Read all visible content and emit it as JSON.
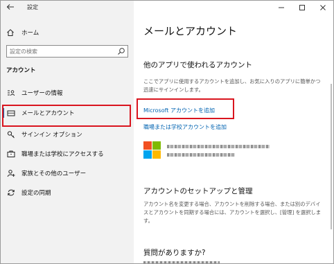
{
  "window": {
    "app_title": "設定",
    "controls": {
      "minimize": "—",
      "maximize": "☐",
      "close": "✕"
    }
  },
  "sidebar": {
    "home_label": "ホーム",
    "search_placeholder": "設定の検索",
    "section_label": "アカウント",
    "items": [
      {
        "label": "ユーザーの情報",
        "icon": "user-info-icon"
      },
      {
        "label": "メールとアカウント",
        "icon": "mail-icon",
        "selected": true
      },
      {
        "label": "サインイン オプション",
        "icon": "key-icon"
      },
      {
        "label": "職場または学校にアクセスする",
        "icon": "briefcase-icon"
      },
      {
        "label": "家族とその他のユーザー",
        "icon": "person-add-icon"
      },
      {
        "label": "設定の同期",
        "icon": "sync-icon"
      }
    ]
  },
  "main": {
    "page_title": "メールとアカウント",
    "other_apps_heading": "他のアプリで使われるアカウント",
    "other_apps_desc": "ここでアプリに使用するアカウントを追加し、お気に入りのアプリに簡単かつ迅速にサインインします。",
    "add_ms_account_link": "Microsoft アカウントを追加",
    "add_work_account_link": "職場または学校アカウントを追加",
    "setup_heading": "アカウントのセットアップと管理",
    "setup_desc": "アカウント名を変更する場合、アカウントを削除する場合、または別のデバイスとアカウントを同期する場合には、アカウントを選択し、[管理] を選択します。",
    "question_heading": "質問がありますか?"
  },
  "colors": {
    "accent": "#0063b1",
    "highlight_outline": "#d9141e",
    "sidebar_bg": "#f2f2f2",
    "ms_red": "#f25022",
    "ms_green": "#7fba00",
    "ms_blue": "#00a4ef",
    "ms_yellow": "#ffb900"
  }
}
